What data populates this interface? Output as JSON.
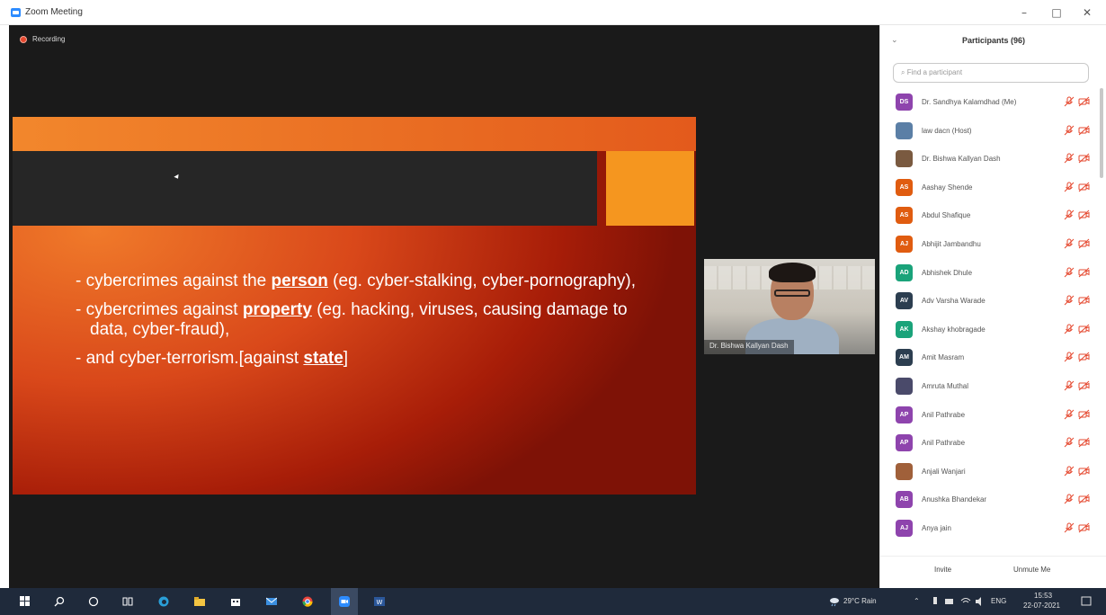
{
  "window": {
    "title": "Zoom Meeting",
    "minimize": "–",
    "maximize": "□",
    "close": "✕"
  },
  "recording": {
    "label": "Recording"
  },
  "slide": {
    "bullets": [
      {
        "prefix": "- cybercrimes against the ",
        "keyword": "person",
        "suffix": " (eg. cyber-stalking, cyber-pornography),"
      },
      {
        "prefix": "- cybercrimes against ",
        "keyword": "property",
        "suffix": " (eg. hacking, viruses, causing damage to data, cyber-fraud),"
      },
      {
        "prefix": "- and cyber-terrorism.[against ",
        "keyword": "state",
        "suffix": "]"
      }
    ]
  },
  "video_thumb": {
    "name": "Dr. Bishwa Kallyan Dash"
  },
  "participants_panel": {
    "collapse_icon": "chevron-down-icon",
    "title": "Participants (96)",
    "search_placeholder": "Find a participant",
    "participants": [
      {
        "initials": "DS",
        "name": "Dr. Sandhya Kalamdhad (Me)",
        "color": "#8e44ad"
      },
      {
        "initials": "",
        "name": "law dacn (Host)",
        "color": "#5b7fa6",
        "photo": true
      },
      {
        "initials": "",
        "name": "Dr. Bishwa Kallyan Dash",
        "color": "#7a5a40",
        "photo": true
      },
      {
        "initials": "AS",
        "name": "Aashay Shende",
        "color": "#e05c10"
      },
      {
        "initials": "AS",
        "name": "Abdul Shafique",
        "color": "#e05c10"
      },
      {
        "initials": "AJ",
        "name": "Abhijit Jambandhu",
        "color": "#e05c10"
      },
      {
        "initials": "AD",
        "name": "Abhishek Dhule",
        "color": "#1aa37a"
      },
      {
        "initials": "AV",
        "name": "Adv Varsha Warade",
        "color": "#2c3e50"
      },
      {
        "initials": "AK",
        "name": "Akshay khobragade",
        "color": "#1aa37a"
      },
      {
        "initials": "AM",
        "name": "Amit Masram",
        "color": "#2c3e50"
      },
      {
        "initials": "",
        "name": "Amruta Muthal",
        "color": "#4a4a6a",
        "photo": true
      },
      {
        "initials": "AP",
        "name": "Anil Pathrabe",
        "color": "#8e44ad"
      },
      {
        "initials": "AP",
        "name": "Anil Pathrabe",
        "color": "#8e44ad"
      },
      {
        "initials": "",
        "name": "Anjali Wanjari",
        "color": "#a0603a",
        "photo": true
      },
      {
        "initials": "AB",
        "name": "Anushka Bhandekar",
        "color": "#8e44ad"
      },
      {
        "initials": "AJ",
        "name": "Anya jain",
        "color": "#8e44ad"
      }
    ],
    "invite_label": "Invite",
    "unmute_label": "Unmute Me"
  },
  "taskbar": {
    "weather": "29°C Rain",
    "language": "ENG",
    "time": "15:53",
    "date": "22-07-2021"
  },
  "colors": {
    "accent_red": "#e5482f",
    "zoom_blue": "#2d8cff",
    "taskbar": "#1f2a3b"
  }
}
